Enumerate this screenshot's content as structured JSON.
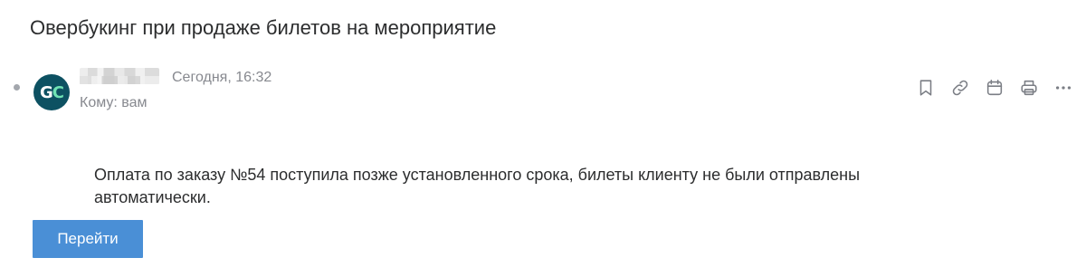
{
  "message": {
    "subject": "Овербукинг при продаже билетов на мероприятие",
    "avatar_initials": {
      "g": "G",
      "c": "C"
    },
    "date": "Сегодня, 16:32",
    "recipient": "Кому: вам",
    "body": "Оплата по заказу №54 поступила позже установленного срока, билеты клиенту не были отправлены автоматически.",
    "button_label": "Перейти"
  },
  "actions": [
    {
      "icon": "bookmark-icon",
      "title": ""
    },
    {
      "icon": "link-icon",
      "title": ""
    },
    {
      "icon": "calendar-icon",
      "title": ""
    },
    {
      "icon": "printer-icon",
      "title": ""
    },
    {
      "icon": "more-icon",
      "title": ""
    }
  ],
  "colors": {
    "accent_button": "#4a8fd6",
    "avatar_bg": "#0d5162",
    "avatar_accent": "#6fe3b4",
    "muted_text": "#87898f"
  }
}
